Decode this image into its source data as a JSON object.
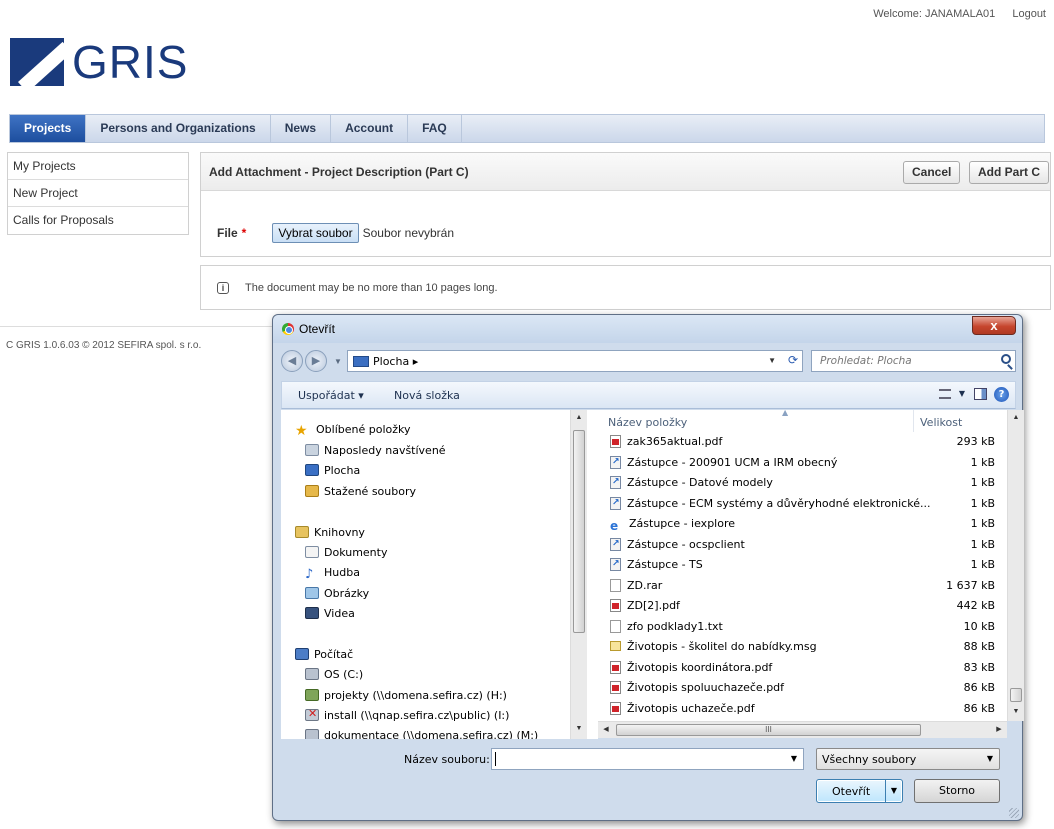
{
  "header": {
    "welcome": "Welcome: JANAMALA01",
    "logout": "Logout",
    "logo_text": "GRIS"
  },
  "nav": {
    "items": [
      {
        "label": "Projects",
        "active": true
      },
      {
        "label": "Persons and Organizations",
        "active": false
      },
      {
        "label": "News",
        "active": false
      },
      {
        "label": "Account",
        "active": false
      },
      {
        "label": "FAQ",
        "active": false
      }
    ]
  },
  "sidebar": {
    "items": [
      {
        "label": "My Projects"
      },
      {
        "label": "New Project"
      },
      {
        "label": "Calls for Proposals"
      }
    ]
  },
  "main": {
    "title": "Add Attachment - Project Description (Part C)",
    "cancel_label": "Cancel",
    "add_label": "Add Part C",
    "file_label": "File",
    "required_mark": "*",
    "file_button": "Vybrat soubor",
    "file_status": "Soubor nevybrán",
    "note_icon": "i",
    "note": "The document may be no more than 10 pages long."
  },
  "footer": {
    "text": "GRIS 1.0.6.03 © 2012 SEFIRA spol. s r.o.",
    "left_fragment": "C"
  },
  "dialog": {
    "title": "Otevřít",
    "close_label": "x",
    "address": "Plocha",
    "address_arrow": "▸",
    "search_placeholder": "Prohledat: Plocha",
    "toolbar": {
      "organize": "Uspořádat ▾",
      "new_folder": "Nová složka",
      "help": "?"
    },
    "tree": [
      {
        "label": "Oblíbené položky",
        "icon": "star-icon"
      },
      {
        "label": "Naposledy navštívené",
        "icon": "recent-icon"
      },
      {
        "label": "Plocha",
        "icon": "desktop-icon"
      },
      {
        "label": "Stažené soubory",
        "icon": "downloads-icon"
      },
      {
        "label": "Knihovny",
        "icon": "libraries-icon"
      },
      {
        "label": "Dokumenty",
        "icon": "documents-icon"
      },
      {
        "label": "Hudba",
        "icon": "music-icon"
      },
      {
        "label": "Obrázky",
        "icon": "pictures-icon"
      },
      {
        "label": "Videa",
        "icon": "videos-icon"
      },
      {
        "label": "Počítač",
        "icon": "computer-icon"
      },
      {
        "label": "OS (C:)",
        "icon": "drive-icon"
      },
      {
        "label": "projekty (\\\\domena.sefira.cz) (H:)",
        "icon": "network-drive-icon"
      },
      {
        "label": "install (\\\\qnap.sefira.cz\\public) (I:)",
        "icon": "disconnected-drive-icon"
      },
      {
        "label": "dokumentace (\\\\domena.sefira.cz) (M:)",
        "icon": "network-drive-icon"
      }
    ],
    "columns": {
      "name": "Název položky",
      "size": "Velikost"
    },
    "files": [
      {
        "name": "zak365aktual.pdf",
        "size": "293 kB",
        "type": "pdf"
      },
      {
        "name": "Zástupce - 200901 UCM a IRM obecný",
        "size": "1 kB",
        "type": "lnk"
      },
      {
        "name": "Zástupce - Datové modely",
        "size": "1 kB",
        "type": "lnk"
      },
      {
        "name": "Zástupce - ECM systémy a důvěryhodné elektronické...",
        "size": "1 kB",
        "type": "lnk"
      },
      {
        "name": "Zástupce - iexplore",
        "size": "1 kB",
        "type": "ie"
      },
      {
        "name": "Zástupce - ocspclient",
        "size": "1 kB",
        "type": "lnk"
      },
      {
        "name": "Zástupce - TS",
        "size": "1 kB",
        "type": "lnk"
      },
      {
        "name": "ZD.rar",
        "size": "1 637 kB",
        "type": "blank"
      },
      {
        "name": "ZD[2].pdf",
        "size": "442 kB",
        "type": "pdf"
      },
      {
        "name": "zfo podklady1.txt",
        "size": "10 kB",
        "type": "blank"
      },
      {
        "name": "Životopis - školitel do nabídky.msg",
        "size": "88 kB",
        "type": "msg"
      },
      {
        "name": "Životopis koordinátora.pdf",
        "size": "83 kB",
        "type": "pdf"
      },
      {
        "name": "Životopis spoluuchazeče.pdf",
        "size": "86 kB",
        "type": "pdf"
      },
      {
        "name": "Životopis uchazeče.pdf",
        "size": "86 kB",
        "type": "pdf"
      }
    ],
    "hscroll_grip": "III",
    "filename_label": "Název souboru:",
    "filename_value": "",
    "filetype": "Všechny soubory",
    "open_label": "Otevřít",
    "cancel_label": "Storno"
  }
}
